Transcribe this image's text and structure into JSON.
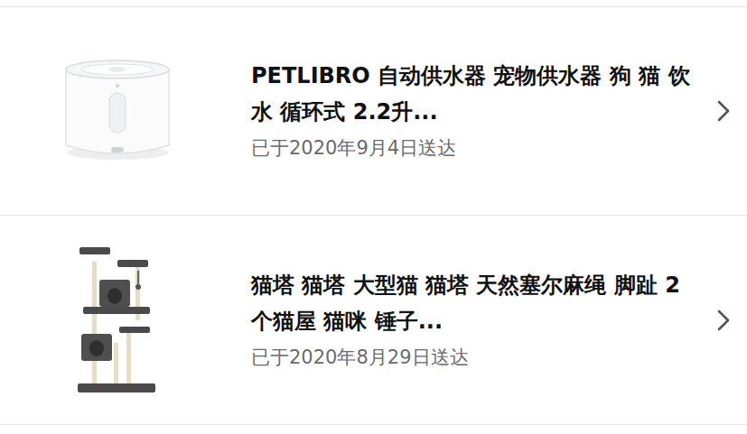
{
  "orders": [
    {
      "title": "PETLIBRO 自动供水器 宠物供水器 狗 猫 饮水 循环式 2.2升...",
      "status": "已于2020年9月4日送达",
      "kind": "fountain"
    },
    {
      "title": "猫塔 猫塔 大型猫 猫塔 天然塞尔麻绳 脚趾 2个猫屋 猫咪 锤子...",
      "status": "已于2020年8月29日送达",
      "kind": "cat-tree"
    }
  ]
}
